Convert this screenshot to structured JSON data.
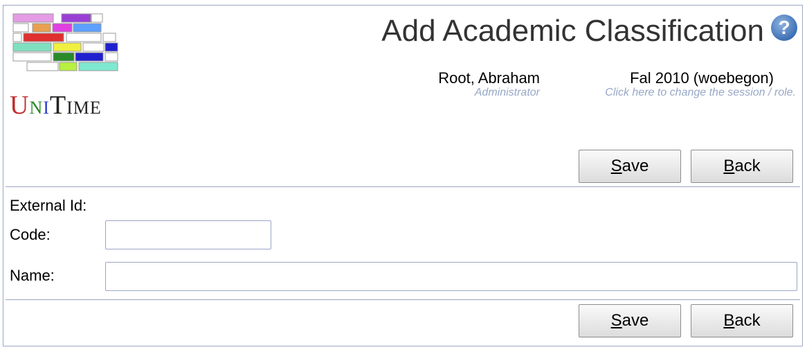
{
  "header": {
    "logo_text": "UniTime",
    "title": "Add Academic Classification",
    "help_icon": "help-icon"
  },
  "user": {
    "name": "Root, Abraham",
    "role": "Administrator"
  },
  "session": {
    "name": "Fal 2010 (woebegon)",
    "hint": "Click here to change the session / role."
  },
  "buttons": {
    "save": {
      "first": "S",
      "rest": "ave"
    },
    "back": {
      "first": "B",
      "rest": "ack"
    }
  },
  "form": {
    "external_id_label": "External Id:",
    "code_label": "Code:",
    "code_value": "",
    "name_label": "Name:",
    "name_value": ""
  }
}
